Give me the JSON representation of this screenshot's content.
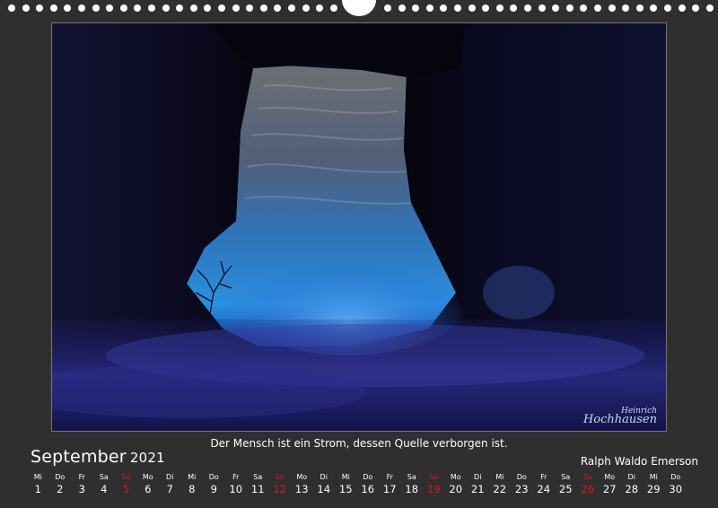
{
  "calendar": {
    "month": "September",
    "year": "2021",
    "quote": "Der Mensch ist ein Strom, dessen Quelle verborgen ist.",
    "author": "Ralph Waldo Emerson",
    "signature": [
      "Heinrich",
      "Hochhausen"
    ],
    "sunday_color": "#e01818",
    "days": [
      {
        "wd": "Mi",
        "d": "1"
      },
      {
        "wd": "Do",
        "d": "2"
      },
      {
        "wd": "Fr",
        "d": "3"
      },
      {
        "wd": "Sa",
        "d": "4"
      },
      {
        "wd": "So",
        "d": "5",
        "sun": true
      },
      {
        "wd": "Mo",
        "d": "6"
      },
      {
        "wd": "Di",
        "d": "7"
      },
      {
        "wd": "Mi",
        "d": "8"
      },
      {
        "wd": "Do",
        "d": "9"
      },
      {
        "wd": "Fr",
        "d": "10"
      },
      {
        "wd": "Sa",
        "d": "11"
      },
      {
        "wd": "So",
        "d": "12",
        "sun": true
      },
      {
        "wd": "Mo",
        "d": "13"
      },
      {
        "wd": "Di",
        "d": "14"
      },
      {
        "wd": "Mi",
        "d": "15"
      },
      {
        "wd": "Do",
        "d": "16"
      },
      {
        "wd": "Fr",
        "d": "17"
      },
      {
        "wd": "Sa",
        "d": "18"
      },
      {
        "wd": "So",
        "d": "19",
        "sun": true
      },
      {
        "wd": "Mo",
        "d": "20"
      },
      {
        "wd": "Di",
        "d": "21"
      },
      {
        "wd": "Mi",
        "d": "22"
      },
      {
        "wd": "Do",
        "d": "23"
      },
      {
        "wd": "Fr",
        "d": "24"
      },
      {
        "wd": "Sa",
        "d": "25"
      },
      {
        "wd": "So",
        "d": "26",
        "sun": true
      },
      {
        "wd": "Mo",
        "d": "27"
      },
      {
        "wd": "Di",
        "d": "28"
      },
      {
        "wd": "Mi",
        "d": "29"
      },
      {
        "wd": "Do",
        "d": "30"
      }
    ]
  }
}
